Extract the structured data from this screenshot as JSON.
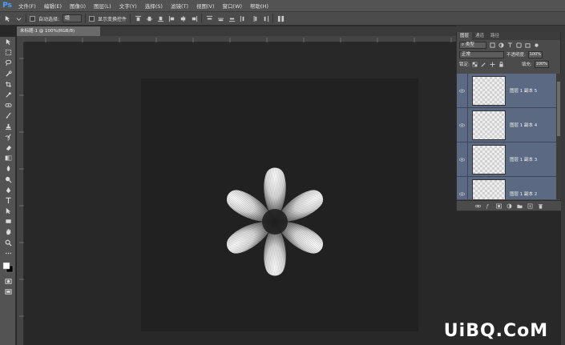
{
  "app": {
    "logo": "Ps"
  },
  "menu": [
    "文件(F)",
    "编辑(E)",
    "图像(I)",
    "图层(L)",
    "文字(Y)",
    "选择(S)",
    "滤镜(T)",
    "视图(V)",
    "窗口(W)",
    "帮助(H)"
  ],
  "options": {
    "auto_select_label": "自动选择:",
    "auto_select_value": "组",
    "show_transform_label": "显示变换控件"
  },
  "document_tab": {
    "title": "未标题-1 @ 100%(RGB/8)"
  },
  "layers_panel": {
    "tabs": [
      "图层",
      "通道",
      "路径"
    ],
    "kind_filter": "类型",
    "blend_mode": "正常",
    "opacity_label": "不透明度:",
    "opacity_value": "100%",
    "lock_label": "锁定:",
    "fill_label": "填充:",
    "fill_value": "100%",
    "layers": [
      {
        "name": "图层 1 副本 5"
      },
      {
        "name": "图层 1 副本 4"
      },
      {
        "name": "图层 1 副本 3"
      },
      {
        "name": "图层 1 副本 2"
      }
    ]
  },
  "watermark": "UiBQ.CoM",
  "colors": {
    "accent": "#4aa3ff",
    "layer_selected": "#5b6a82",
    "canvas": "#212121",
    "workspace": "#282828"
  }
}
